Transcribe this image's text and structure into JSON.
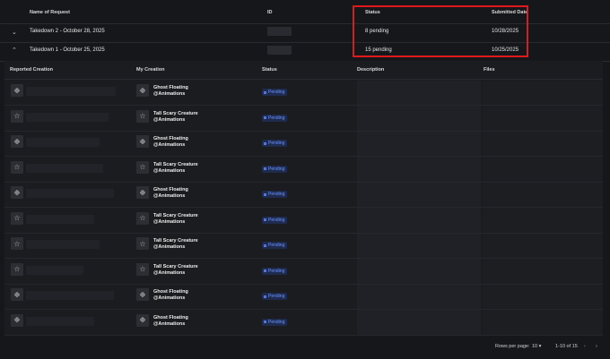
{
  "table": {
    "headers": {
      "name": "Name of Request",
      "id": "ID",
      "status": "Status",
      "date": "Submitted Date"
    },
    "requests": [
      {
        "name": "Takedown 2 - October 28, 2025",
        "status": "8 pending",
        "date": "10/28/2025",
        "chevron": "chevron-down"
      },
      {
        "name": "Takedown 1 - October 25, 2025",
        "status": "15 pending",
        "date": "10/25/2025",
        "chevron": "chevron-up"
      }
    ]
  },
  "detail": {
    "headers": {
      "reported": "Reported Creation",
      "my": "My Creation",
      "status": "Status",
      "description": "Description",
      "files": "Files"
    },
    "rows": [
      {
        "title": "Ghost Floating",
        "handle": "@Animations",
        "status": "Pending",
        "icon": "ghost-icon"
      },
      {
        "title": "Tall Scary Creature",
        "handle": "@Animations",
        "status": "Pending",
        "icon": "creature-icon"
      },
      {
        "title": "Ghost Floating",
        "handle": "@Animations",
        "status": "Pending",
        "icon": "ghost-icon"
      },
      {
        "title": "Tall Scary Creature",
        "handle": "@Animations",
        "status": "Pending",
        "icon": "creature-icon"
      },
      {
        "title": "Ghost Floating",
        "handle": "@Animations",
        "status": "Pending",
        "icon": "ghost-icon"
      },
      {
        "title": "Tall Scary Creature",
        "handle": "@Animations",
        "status": "Pending",
        "icon": "creature-icon"
      },
      {
        "title": "Tall Scary Creature",
        "handle": "@Animations",
        "status": "Pending",
        "icon": "creature-icon"
      },
      {
        "title": "Tall Scary Creature",
        "handle": "@Animations",
        "status": "Pending",
        "icon": "creature-icon"
      },
      {
        "title": "Ghost Floating",
        "handle": "@Animations",
        "status": "Pending",
        "icon": "ghost-icon"
      },
      {
        "title": "Ghost Floating",
        "handle": "@Animations",
        "status": "Pending",
        "icon": "ghost-icon"
      }
    ]
  },
  "pagination": {
    "rows_label": "Rows per page:",
    "rows_value": "10",
    "range": "1-10 of 15"
  },
  "colors": {
    "accent": "#6e95ff",
    "highlight": "#e0191b"
  }
}
